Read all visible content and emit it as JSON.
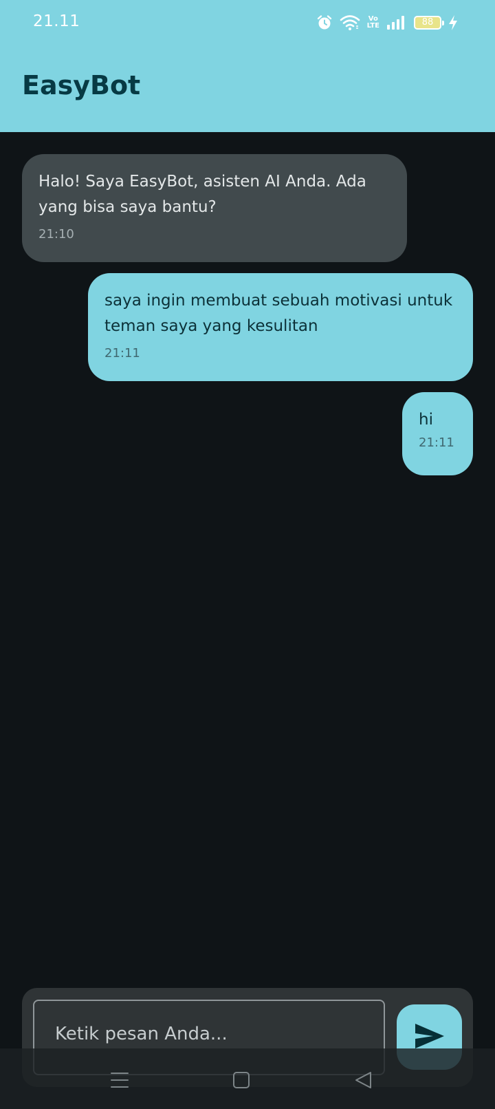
{
  "status_bar": {
    "time": "21.11",
    "icons": [
      "alarm-icon",
      "wifi-icon",
      "volte-icon",
      "signal-icon",
      "battery-icon",
      "charging-icon"
    ],
    "volte_top": "Vo",
    "volte_bottom": "LTE",
    "battery_level": "88"
  },
  "app_bar": {
    "title": "EasyBot"
  },
  "messages": [
    {
      "sender": "bot",
      "text": "Halo! Saya EasyBot, asisten AI Anda. Ada yang bisa saya bantu?",
      "time": "21:10"
    },
    {
      "sender": "user",
      "text": "saya ingin membuat sebuah motivasi untuk teman saya yang kesulitan",
      "time": "21:11"
    },
    {
      "sender": "user",
      "text": "hi",
      "time": "21:11"
    }
  ],
  "composer": {
    "placeholder": "Ketik pesan Anda...",
    "value": "",
    "send_icon": "send-icon"
  },
  "nav_bar": {
    "buttons": [
      "menu-icon",
      "home-icon",
      "back-icon"
    ]
  },
  "colors": {
    "accent": "#80d4e1",
    "background": "#0f1417",
    "bot_bubble": "#414a4d",
    "title": "#073a44"
  }
}
